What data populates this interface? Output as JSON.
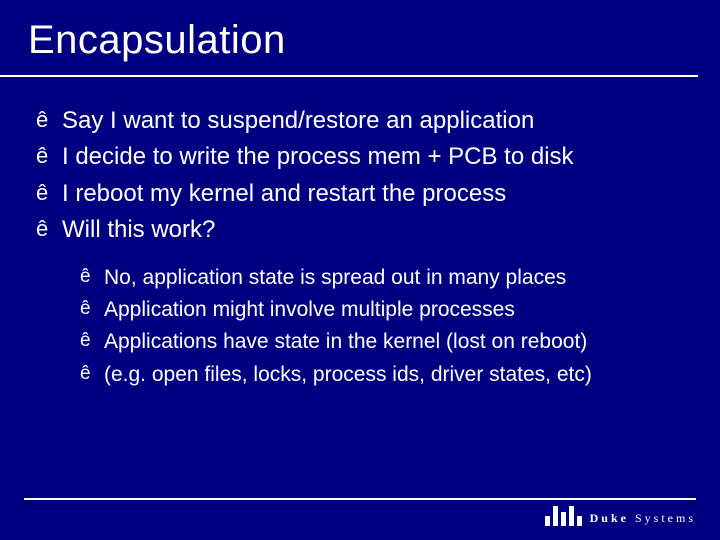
{
  "title": "Encapsulation",
  "bullet_glyph": "ê",
  "level1": [
    "Say I want to suspend/restore an application",
    "I decide to write the process mem + PCB to disk",
    "I reboot my kernel and restart the process",
    "Will this work?"
  ],
  "level2": [
    "No, application state is spread out in many places",
    "Application might involve multiple processes",
    "Applications have state in the kernel (lost on reboot)",
    "(e.g. open files, locks, process ids, driver states, etc)"
  ],
  "brand": {
    "word1": "Duke",
    "word2": "Systems"
  }
}
